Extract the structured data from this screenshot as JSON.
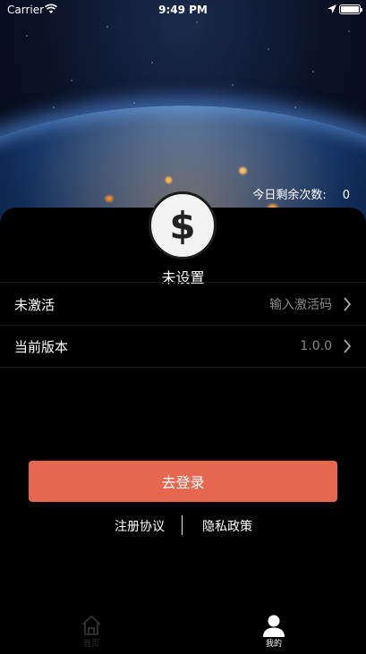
{
  "status_bar": {
    "carrier": "Carrier",
    "time": "9:49 PM"
  },
  "header": {
    "remaining_label": "今日剩余次数:",
    "remaining_count": "0"
  },
  "profile": {
    "avatar_icon": "dollar-icon",
    "name": "未设置"
  },
  "rows": [
    {
      "label": "未激活",
      "value": "输入激活码"
    },
    {
      "label": "当前版本",
      "value": "1.0.0"
    }
  ],
  "actions": {
    "login_label": "去登录",
    "register_agreement": "注册协议",
    "privacy_policy": "隐私政策"
  },
  "tabbar": {
    "home_label": "首页",
    "mine_label": "我的"
  },
  "colors": {
    "accent": "#e5674f",
    "background": "#000000"
  }
}
